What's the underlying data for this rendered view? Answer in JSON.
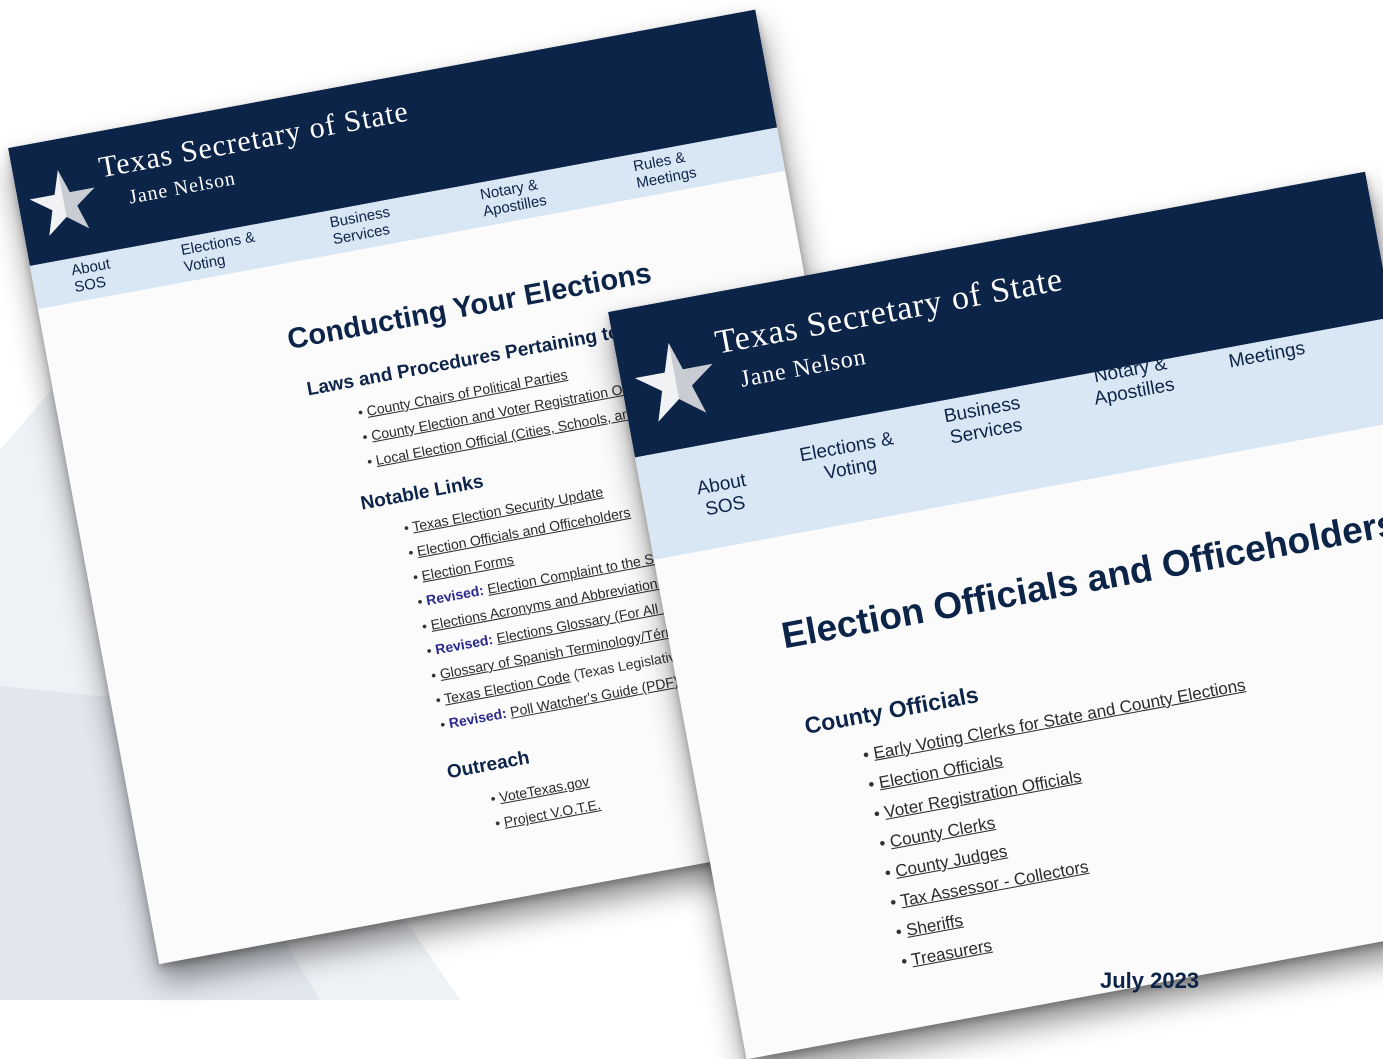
{
  "site": {
    "title": "Texas Secretary of State",
    "subtitle": "Jane Nelson",
    "brand_color": "#0c2448",
    "nav_color": "#d9e6f3"
  },
  "card1": {
    "nav": [
      "About SOS",
      "Elections & Voting",
      "Business Services",
      "Notary & Apostilles",
      "Rules & Meetings"
    ],
    "heading": "Conducting Your Elections",
    "sections": {
      "laws": {
        "title": "Laws and Procedures Pertaining to:",
        "items": [
          "County Chairs of Political Parties",
          "County Election and Voter Registration Officials",
          "Local Election Official (Cities, Schools, and Othe"
        ]
      },
      "notable": {
        "title": "Notable Links",
        "items": [
          {
            "prefix": "",
            "link": "Texas Election Security Update",
            "suffix": ""
          },
          {
            "prefix": "",
            "link": "Election Officials and Officeholders",
            "suffix": ""
          },
          {
            "prefix": "",
            "link": "Election Forms",
            "suffix": ""
          },
          {
            "prefix": "Revised:",
            "link": "Election Complaint to the Secretary of",
            "suffix": ""
          },
          {
            "prefix": "",
            "link": "Elections Acronyms and Abbreviations",
            "suffix": ""
          },
          {
            "prefix": "Revised:",
            "link": "Elections Glossary (For All Election Of",
            "suffix": ""
          },
          {
            "prefix": "",
            "link": "Glossary of Spanish Terminology/Términos de E",
            "suffix": ""
          },
          {
            "prefix": "",
            "link": "Texas Election Code",
            "suffix": " (Texas Legislative Council)"
          },
          {
            "prefix": "Revised:",
            "link": "Poll Watcher's Guide (PDF)",
            "suffix": ""
          }
        ]
      },
      "outreach": {
        "title": "Outreach",
        "items": [
          "VoteTexas.gov",
          "Project V.O.T.E."
        ]
      }
    }
  },
  "card2": {
    "nav": [
      "About SOS",
      "Elections & Voting",
      "Business Services",
      "Notary & Apostilles",
      "Rules & Meetings"
    ],
    "heading": "Election Officials and Officeholders",
    "section_title": "County Officials",
    "items": [
      "Early Voting Clerks for State and County Elections",
      "Election Officials",
      "Voter Registration Officials",
      "County Clerks",
      "County Judges",
      "Tax Assessor - Collectors",
      "Sheriffs",
      "Treasurers"
    ]
  },
  "footer": {
    "date": "July 2023"
  }
}
